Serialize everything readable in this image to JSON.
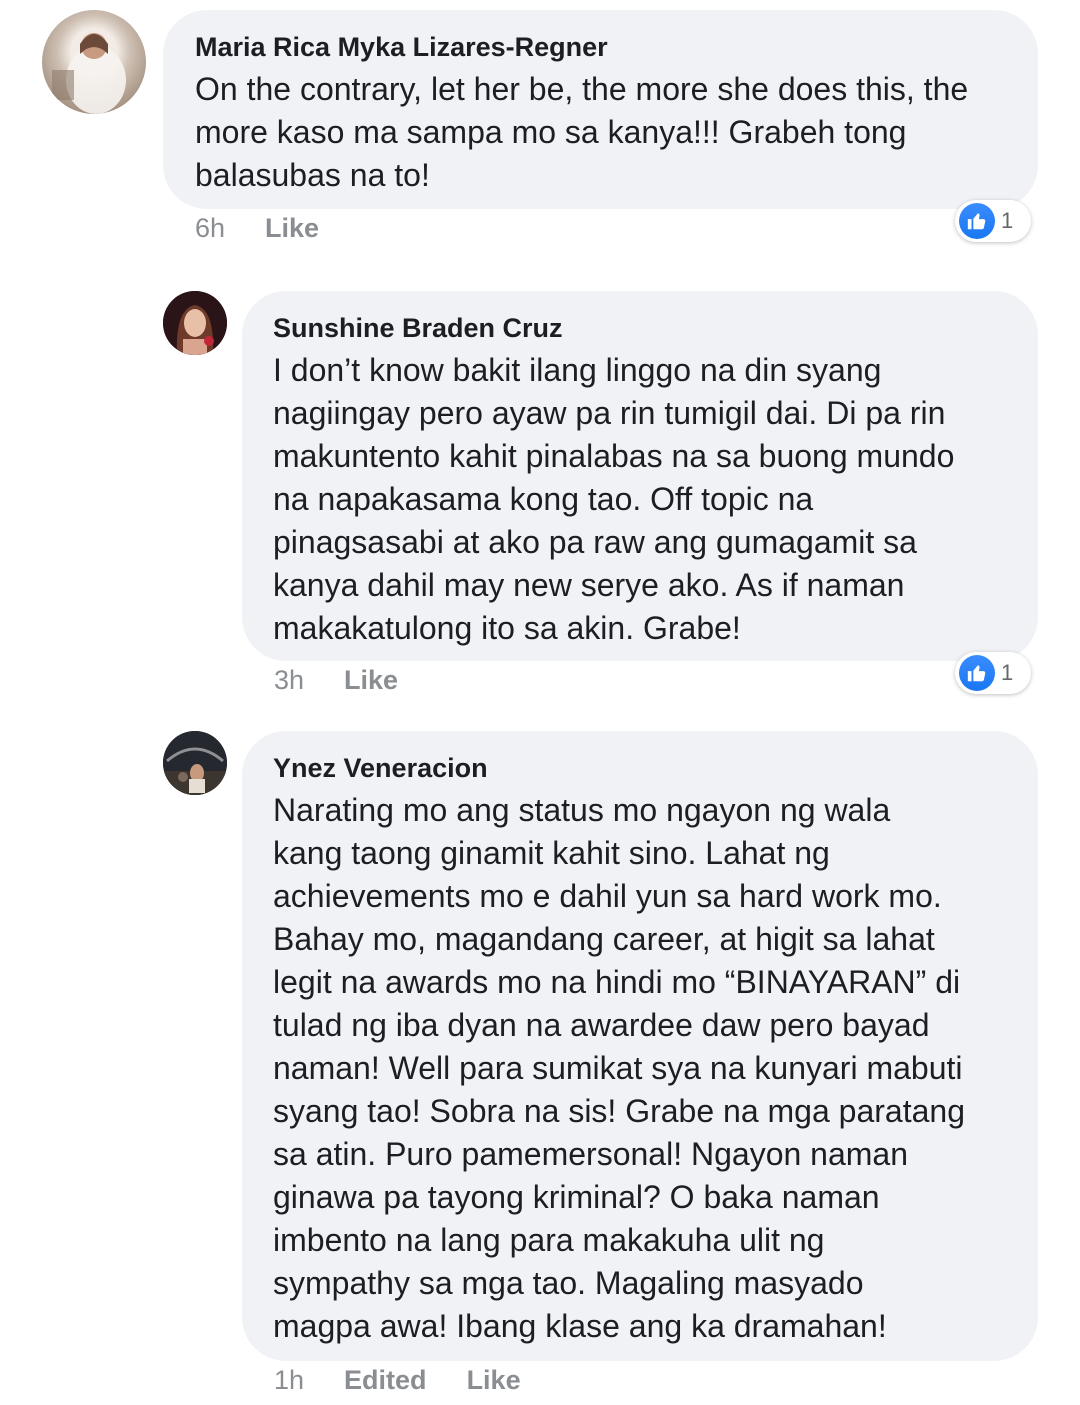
{
  "comments": [
    {
      "author": "Maria Rica Myka Lizares-Regner",
      "text": "On the contrary,  let her be, the more she does this, the\nmore kaso ma sampa mo sa kanya!!! Grabeh tong\nbalasubas na to!",
      "time": "6h",
      "like_label": "Like",
      "reaction_count": "1"
    },
    {
      "author": "Sunshine Braden Cruz",
      "text": "I don’t know bakit ilang linggo na din syang\nnagiingay pero ayaw pa rin tumigil dai. Di pa rin\nmakuntento kahit pinalabas na sa buong mundo\nna napakasama kong tao. Off topic na\npinagsasabi at ako pa raw ang gumagamit sa\nkanya dahil may new serye ako. As if naman\nmakakatulong ito sa akin. Grabe!",
      "time": "3h",
      "like_label": "Like",
      "reaction_count": "1"
    },
    {
      "author": "Ynez Veneracion",
      "text": "Narating mo ang status mo ngayon ng wala\nkang taong ginamit kahit sino. Lahat ng\nachievements mo e dahil yun sa hard work mo.\nBahay mo, magandang career, at higit sa lahat\nlegit na awards mo na hindi mo “BINAYARAN” di\ntulad ng iba dyan na awardee daw pero bayad\nnaman! Well para sumikat sya na kunyari mabuti\nsyang tao! Sobra na sis! Grabe na mga paratang\nsa atin. Puro pamemersonal! Ngayon naman\nginawa pa tayong kriminal? O baka naman\nimbento na lang para makakuha ulit ng\nsympathy sa mga tao. Magaling masyado\nmagpa awa! Ibang klase ang ka dramahan!",
      "time": "1h",
      "edited_label": "Edited",
      "like_label": "Like"
    }
  ],
  "colors": {
    "bubble": "#f0f2f5",
    "text": "#1c1e21",
    "meta": "#8a8d91",
    "like_blue": "#1877f2"
  },
  "icons": {
    "reaction": "thumbs-up-icon"
  }
}
